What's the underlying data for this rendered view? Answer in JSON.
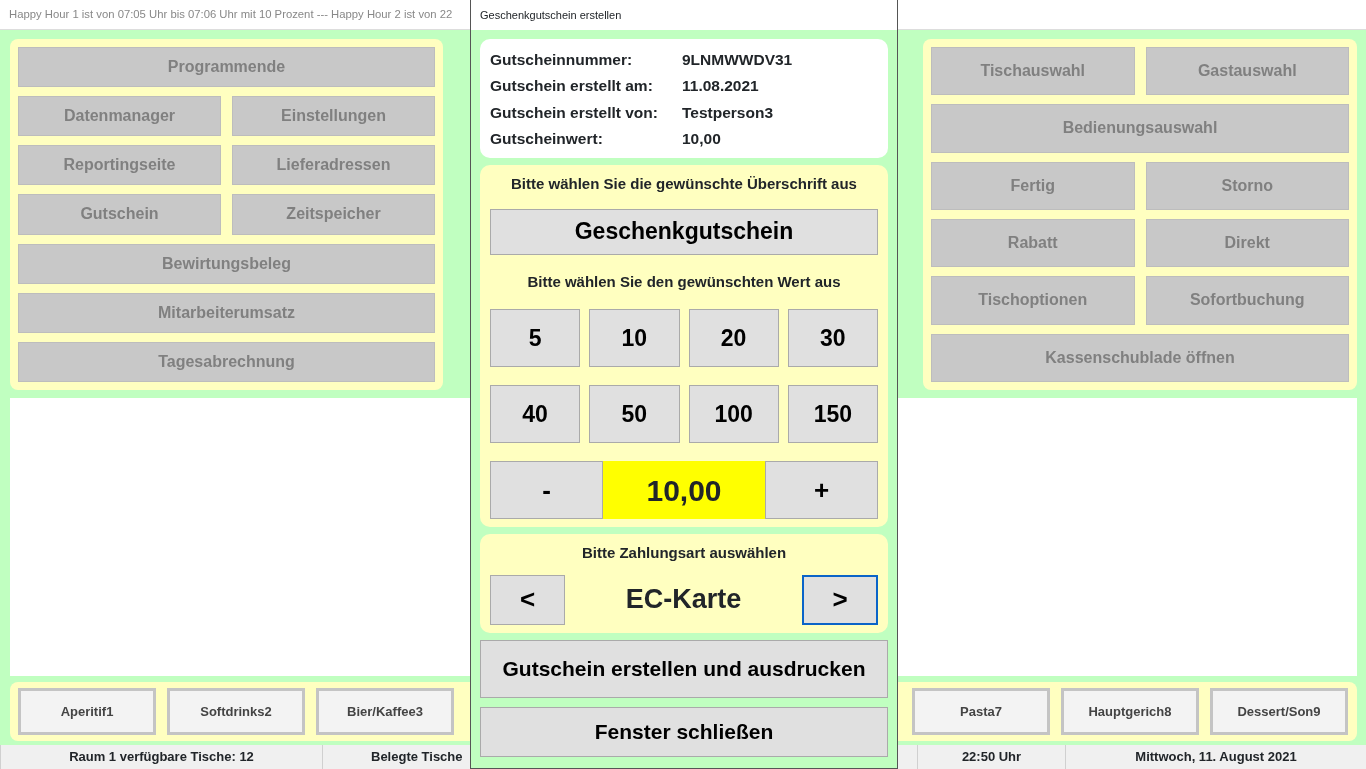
{
  "app": {
    "ticker": "Happy Hour 1 ist von 07:05 Uhr bis 07:06 Uhr mit 10 Prozent --- Happy Hour 2 ist von 22",
    "left_panel": [
      [
        "Programmende"
      ],
      [
        "Datenmanager",
        "Einstellungen"
      ],
      [
        "Reportingseite",
        "Lieferadressen"
      ],
      [
        "Gutschein",
        "Zeitspeicher"
      ],
      [
        "Bewirtungsbeleg"
      ],
      [
        "Mitarbeiterumsatz"
      ],
      [
        "Tagesabrechnung"
      ]
    ],
    "right_panel": [
      [
        "Tischauswahl",
        "Gastauswahl"
      ],
      [
        "Bedienungsauswahl"
      ],
      [
        "Fertig",
        "Storno"
      ],
      [
        "Rabatt",
        "Direkt"
      ],
      [
        "Tischoptionen",
        "Sofortbuchung"
      ],
      [
        "Kassenschublade öffnen"
      ]
    ],
    "categories": [
      "Aperitif1",
      "Softdrinks2",
      "Bier/Kaffee3",
      "Pasta7",
      "Hauptgerich8",
      "Dessert/Son9"
    ],
    "status_bar": [
      "Raum 1 verfügbare Tische: 12",
      "Belegte Tische",
      "22:50 Uhr",
      "Mittwoch, 11. August 2021"
    ]
  },
  "dialog": {
    "title": "Geschenkgutschein erstellen",
    "info": [
      {
        "label": "Gutscheinnummer:",
        "value": "9LNMWWDV31"
      },
      {
        "label": "Gutschein erstellt am:",
        "value": "11.08.2021"
      },
      {
        "label": "Gutschein erstellt von:",
        "value": "Testperson3"
      },
      {
        "label": "Gutscheinwert:",
        "value": "10,00"
      }
    ],
    "heading_prompt": "Bitte wählen Sie die gewünschte Überschrift aus",
    "heading_button": "Geschenkgutschein",
    "value_prompt": "Bitte wählen Sie den gewünschten Wert aus",
    "values": [
      "5",
      "10",
      "20",
      "30",
      "40",
      "50",
      "100",
      "150"
    ],
    "minus": "-",
    "amount": "10,00",
    "plus": "+",
    "payment_prompt": "Bitte Zahlungsart auswählen",
    "payment_prev": {
      "label": "<",
      "focused": false
    },
    "payment_method": "EC-Karte",
    "payment_next": {
      "label": ">",
      "focused": true
    },
    "buttons": [
      "Gutschein erstellen und ausdrucken",
      "Fenster schließen"
    ]
  }
}
